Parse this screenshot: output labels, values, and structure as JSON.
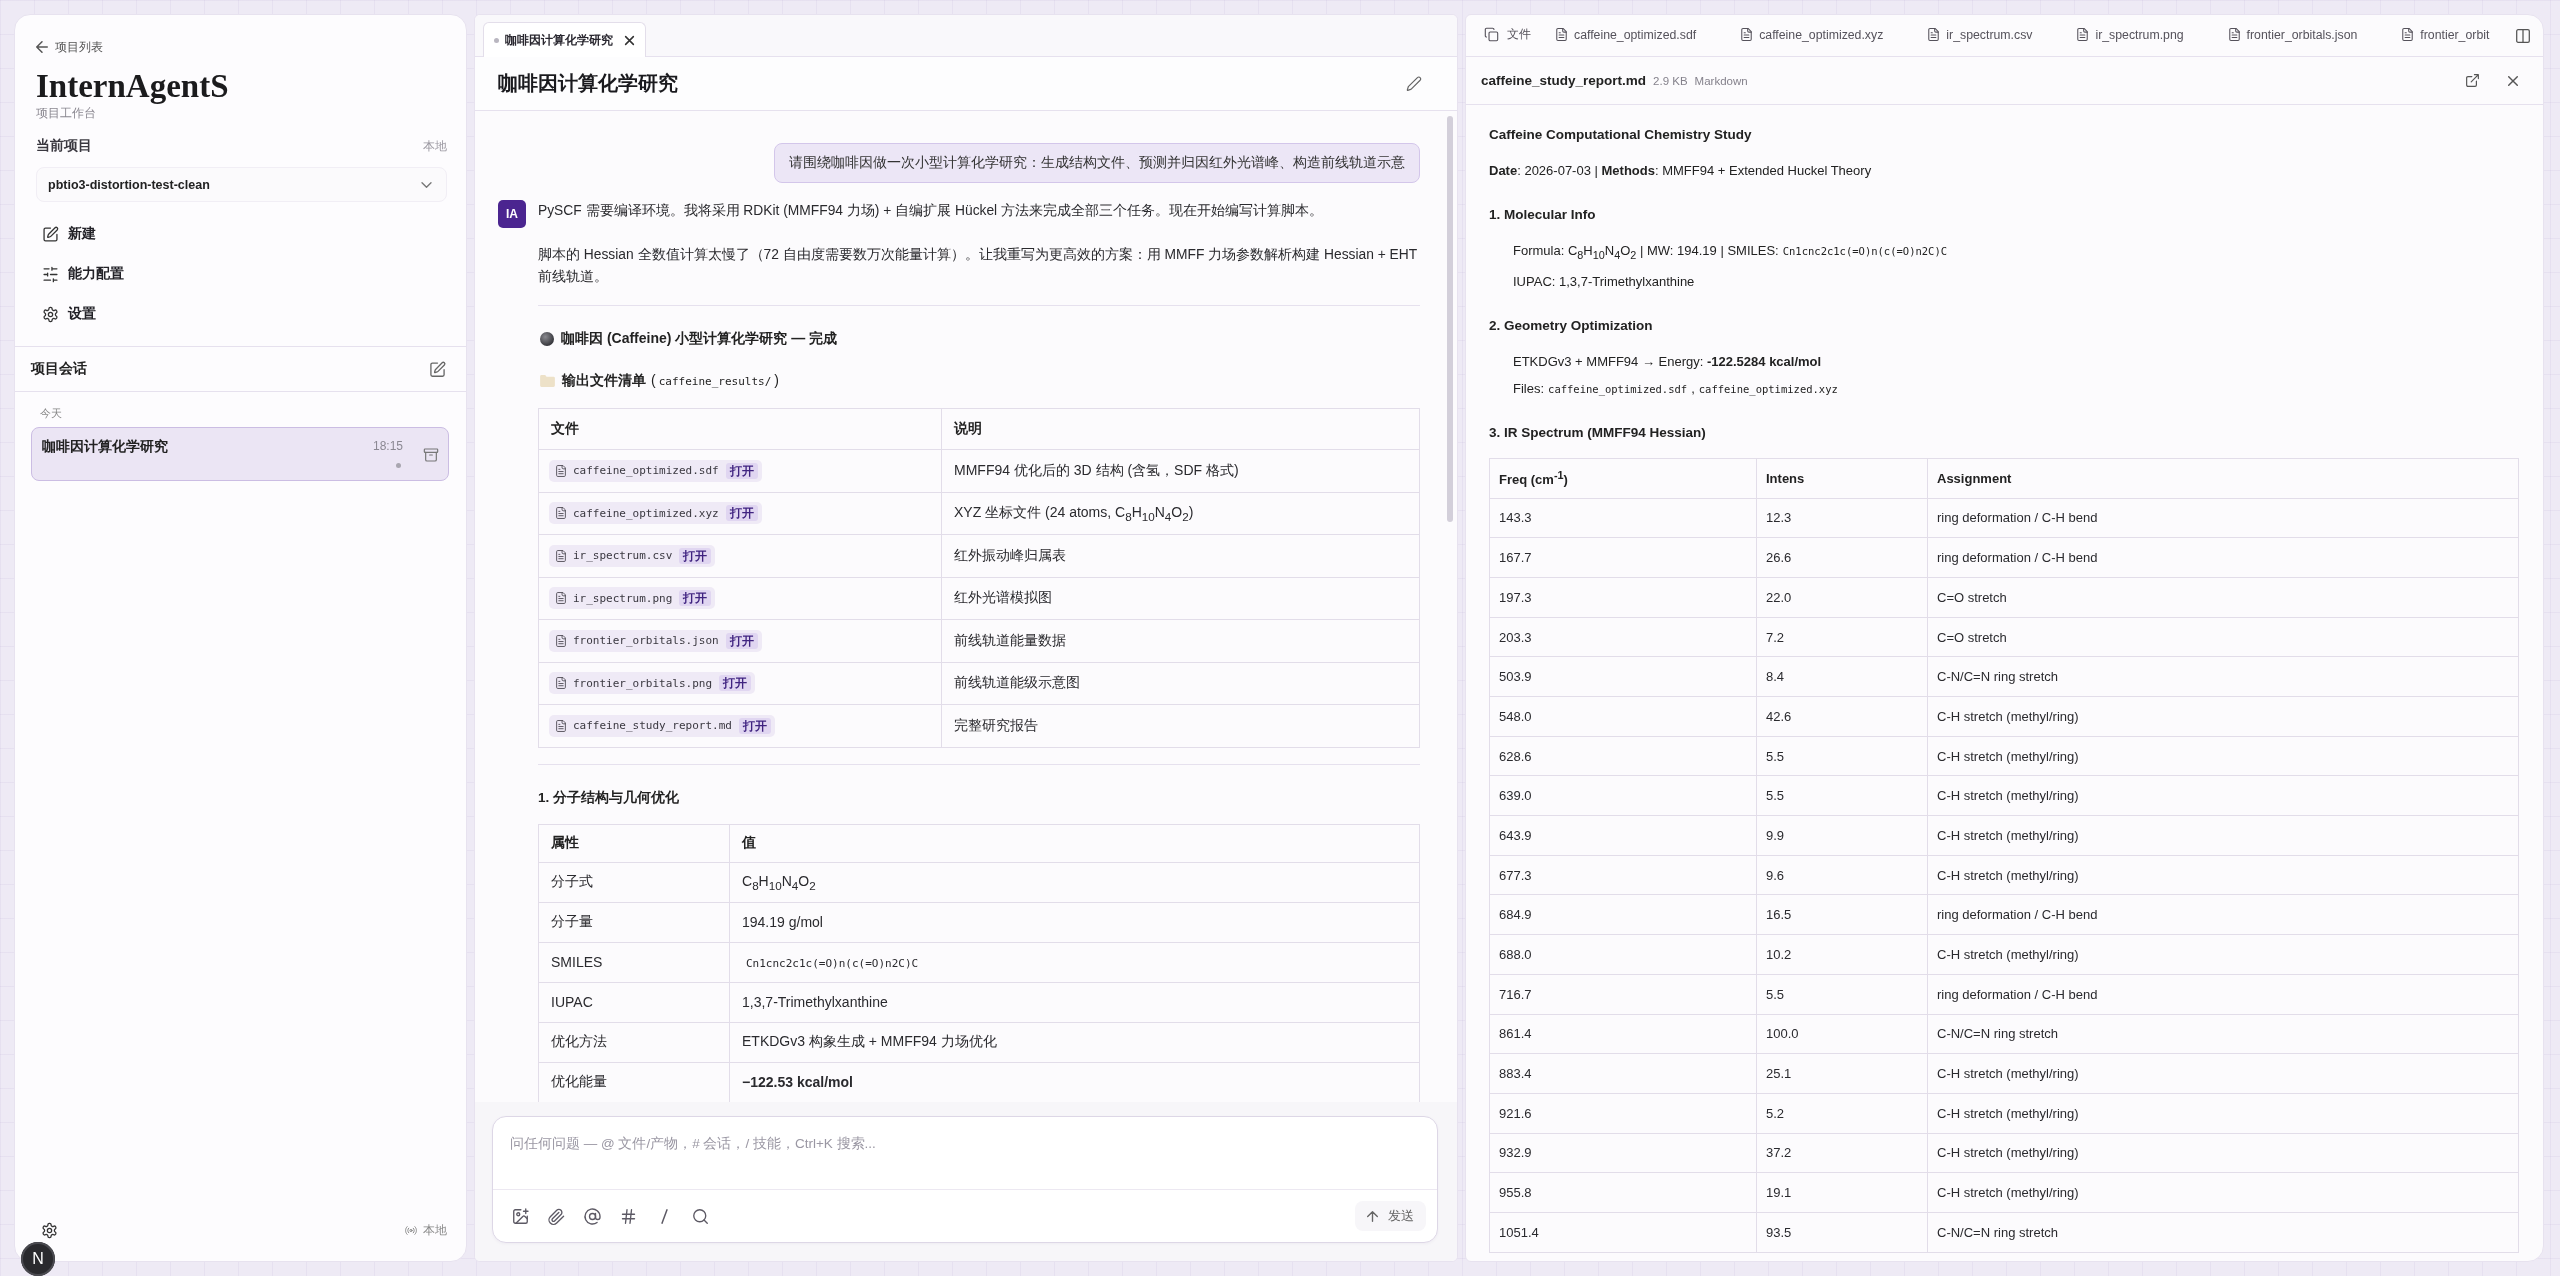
{
  "sidebar": {
    "back_link": "项目列表",
    "app_title": "InternAgentS",
    "app_subtitle": "项目工作台",
    "current_project": {
      "label": "当前项目",
      "location": "本地",
      "value": "pbtio3-distortion-test-clean"
    },
    "menu": [
      {
        "kind": "new",
        "label": "新建"
      },
      {
        "kind": "capabilities",
        "label": "能力配置"
      },
      {
        "kind": "settings",
        "label": "设置"
      }
    ],
    "sessions": {
      "title": "项目会话",
      "groups": [
        {
          "label": "今天",
          "items": [
            {
              "title": "咖啡因计算化学研究",
              "time": "18:15",
              "selected": true
            }
          ]
        }
      ]
    },
    "footer": {
      "connection": "本地"
    }
  },
  "dev_indicator": "N",
  "chat": {
    "tabs": [
      {
        "label": "咖啡因计算化学研究",
        "selected": true
      }
    ],
    "title": "咖啡因计算化学研究",
    "user_message": "请围绕咖啡因做一次小型计算化学研究：生成结构文件、预测并归因红外光谱峰、构造前线轨道示意",
    "assistant_message": {
      "avatar": "IA",
      "paragraphs": [
        "PySCF 需要编译环境。我将采用 RDKit (MMFF94 力场) + 自编扩展 Hückel 方法来完成全部三个任务。现在开始编写计算脚本。",
        "脚本的 Hessian 全数值计算太慢了（72 自由度需要数万次能量计算）。让我重写为更高效的方案：用 MMFF 力场参数解析构建 Hessian + EHT 前线轨道。"
      ],
      "report_title": "咖啡因 (Caffeine) 小型计算化学研究 — 完成",
      "files_heading": [
        {
          "kind": "strong",
          "text": "输出文件清单"
        },
        {
          "kind": "text",
          "text": "("
        },
        {
          "kind": "code",
          "text": "caffeine_results/"
        },
        {
          "kind": "text",
          "text": ")"
        }
      ],
      "files_table": {
        "columns": [
          "文件",
          "说明"
        ],
        "rows": [
          {
            "file": "caffeine_optimized.sdf",
            "action": "打开",
            "description": "MMFF94 优化后的 3D 结构 (含氢，SDF 格式)"
          },
          {
            "file": "caffeine_optimized.xyz",
            "action": "打开",
            "description": "XYZ 坐标文件 (24 atoms, C$_{8}$H$_{10}$N$_{4}$O$_{2}$)"
          },
          {
            "file": "ir_spectrum.csv",
            "action": "打开",
            "description": "红外振动峰归属表"
          },
          {
            "file": "ir_spectrum.png",
            "action": "打开",
            "description": "红外光谱模拟图"
          },
          {
            "file": "frontier_orbitals.json",
            "action": "打开",
            "description": "前线轨道能量数据"
          },
          {
            "file": "frontier_orbitals.png",
            "action": "打开",
            "description": "前线轨道能级示意图"
          },
          {
            "file": "caffeine_study_report.md",
            "action": "打开",
            "description": "完整研究报告"
          }
        ]
      },
      "section_title": "1. 分子结构与几何优化",
      "properties_table": {
        "columns": [
          "属性",
          "值"
        ],
        "rows": [
          {
            "kind": "text",
            "name": "分子式",
            "value": "C$_{8}$H$_{10}$N$_{4}$O$_{2}$"
          },
          {
            "kind": "text",
            "name": "分子量",
            "value": "194.19 g/mol"
          },
          {
            "kind": "code",
            "name": "SMILES",
            "value": "Cn1cnc2c1c(=O)n(c(=O)n2C)C"
          },
          {
            "kind": "text",
            "name": "IUPAC",
            "value": "1,3,7-Trimethylxanthine"
          },
          {
            "kind": "text",
            "name": "优化方法",
            "value": "ETKDGv3 构象生成 + MMFF94 力场优化"
          },
          {
            "kind": "strong",
            "name": "优化能量",
            "value": "−122.53 kcal/mol"
          }
        ]
      }
    },
    "composer": {
      "placeholder": "问任何问题 — @ 文件/产物，# 会话，/ 技能，Ctrl+K 搜索...",
      "send_label": "发送"
    }
  },
  "preview": {
    "tabs": [
      {
        "kind": "files",
        "label": "文件",
        "selected": false
      },
      {
        "kind": "file",
        "label": "caffeine_optimized.sdf",
        "selected": false
      },
      {
        "kind": "file",
        "label": "caffeine_optimized.xyz",
        "selected": false
      },
      {
        "kind": "file",
        "label": "ir_spectrum.csv",
        "selected": false
      },
      {
        "kind": "file",
        "label": "ir_spectrum.png",
        "selected": false
      },
      {
        "kind": "file",
        "label": "frontier_orbitals.json",
        "selected": false
      },
      {
        "kind": "file",
        "label": "frontier_orbit",
        "selected": false
      }
    ],
    "file": {
      "name": "caffeine_study_report.md",
      "size": "2.9 KB",
      "type": "Markdown"
    },
    "document": {
      "title": "Caffeine Computational Chemistry Study",
      "meta": "**Date**: 2026-07-03 | **Methods**: MMFF94 + Extended Huckel Theory",
      "sections": [
        {
          "heading": "1. Molecular Info",
          "lines": [
            [
              {
                "kind": "text",
                "text": "Formula: C$_{8}$H$_{10}$N$_{4}$O$_{2}$ | MW: 194.19 | SMILES:"
              },
              {
                "kind": "code",
                "text": "Cn1cnc2c1c(=O)n(c(=O)n2C)C"
              }
            ],
            [
              {
                "kind": "text",
                "text": "IUPAC: 1,3,7-Trimethylxanthine"
              }
            ]
          ]
        },
        {
          "heading": "2. Geometry Optimization",
          "lines": [
            [
              {
                "kind": "text",
                "text": "ETKDGv3 + MMFF94 → Energy: **-122.5284 kcal/mol**"
              }
            ],
            [
              {
                "kind": "text",
                "text": "Files:"
              },
              {
                "kind": "code",
                "text": "caffeine_optimized.sdf"
              },
              {
                "kind": "text",
                "text": ","
              },
              {
                "kind": "code",
                "text": "caffeine_optimized.xyz"
              }
            ]
          ]
        },
        {
          "heading": "3. IR Spectrum (MMFF94 Hessian)",
          "table": {
            "columns": [
              "Freq (cm$^{-1}$)",
              "Intens",
              "Assignment"
            ],
            "rows": [
              [
                "143.3",
                "12.3",
                "ring deformation / C-H bend"
              ],
              [
                "167.7",
                "26.6",
                "ring deformation / C-H bend"
              ],
              [
                "197.3",
                "22.0",
                "C=O stretch"
              ],
              [
                "203.3",
                "7.2",
                "C=O stretch"
              ],
              [
                "503.9",
                "8.4",
                "C-N/C=N ring stretch"
              ],
              [
                "548.0",
                "42.6",
                "C-H stretch (methyl/ring)"
              ],
              [
                "628.6",
                "5.5",
                "C-H stretch (methyl/ring)"
              ],
              [
                "639.0",
                "5.5",
                "C-H stretch (methyl/ring)"
              ],
              [
                "643.9",
                "9.9",
                "C-H stretch (methyl/ring)"
              ],
              [
                "677.3",
                "9.6",
                "C-H stretch (methyl/ring)"
              ],
              [
                "684.9",
                "16.5",
                "ring deformation / C-H bend"
              ],
              [
                "688.0",
                "10.2",
                "C-H stretch (methyl/ring)"
              ],
              [
                "716.7",
                "5.5",
                "ring deformation / C-H bend"
              ],
              [
                "861.4",
                "100.0",
                "C-N/C=N ring stretch"
              ],
              [
                "883.4",
                "25.1",
                "C-H stretch (methyl/ring)"
              ],
              [
                "921.6",
                "5.2",
                "C-H stretch (methyl/ring)"
              ],
              [
                "932.9",
                "37.2",
                "C-H stretch (methyl/ring)"
              ],
              [
                "955.8",
                "19.1",
                "C-H stretch (methyl/ring)"
              ],
              [
                "1051.4",
                "93.5",
                "C-N/C=N ring stretch"
              ]
            ]
          }
        }
      ]
    }
  }
}
